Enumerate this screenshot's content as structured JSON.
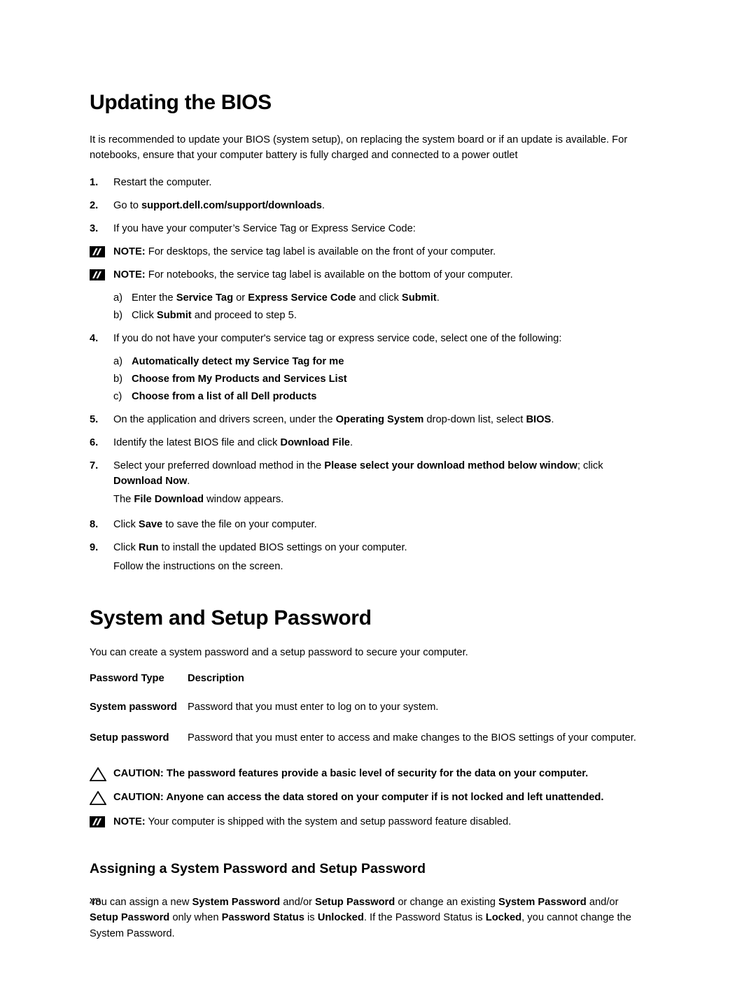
{
  "page": {
    "number": "48"
  },
  "section1": {
    "heading": "Updating the BIOS",
    "intro": "It is recommended to update your BIOS (system setup), on replacing the system board or if an update is available. For notebooks, ensure that your computer battery is fully charged and connected to a power outlet",
    "steps": [
      {
        "num": "1.",
        "text": "Restart the computer."
      },
      {
        "num": "2.",
        "text_parts": [
          {
            "t": "Go to ",
            "b": false
          },
          {
            "t": "support.dell.com/support/downloads",
            "b": true
          },
          {
            "t": ".",
            "b": false
          }
        ]
      },
      {
        "num": "3.",
        "text": "If you have your computer’s Service Tag or Express Service Code:"
      }
    ],
    "note1": {
      "label": "NOTE:",
      "text": " For desktops, the service tag label is available on the front of your computer."
    },
    "note2": {
      "label": "NOTE:",
      "text": " For notebooks, the service tag label is available on the bottom of your computer."
    },
    "sub3": [
      {
        "letter": "a)",
        "parts": [
          {
            "t": "Enter the ",
            "b": false
          },
          {
            "t": "Service Tag",
            "b": true
          },
          {
            "t": " or ",
            "b": false
          },
          {
            "t": "Express Service Code",
            "b": true
          },
          {
            "t": " and click ",
            "b": false
          },
          {
            "t": "Submit",
            "b": true
          },
          {
            "t": ".",
            "b": false
          }
        ]
      },
      {
        "letter": "b)",
        "parts": [
          {
            "t": "Click ",
            "b": false
          },
          {
            "t": "Submit",
            "b": true
          },
          {
            "t": " and proceed to step 5.",
            "b": false
          }
        ]
      }
    ],
    "step4": {
      "num": "4.",
      "text": "If you do not have your computer's service tag or express service code, select one of the following:"
    },
    "sub4": [
      {
        "letter": "a)",
        "parts": [
          {
            "t": "Automatically detect my Service Tag for me",
            "b": true
          }
        ]
      },
      {
        "letter": "b)",
        "parts": [
          {
            "t": "Choose from My Products and Services List",
            "b": true
          }
        ]
      },
      {
        "letter": "c)",
        "parts": [
          {
            "t": "Choose from a list of all Dell products",
            "b": true
          }
        ]
      }
    ],
    "steps_rest": [
      {
        "num": "5.",
        "parts": [
          {
            "t": "On the application and drivers screen, under the ",
            "b": false
          },
          {
            "t": "Operating System",
            "b": true
          },
          {
            "t": " drop-down list, select ",
            "b": false
          },
          {
            "t": "BIOS",
            "b": true
          },
          {
            "t": ".",
            "b": false
          }
        ]
      },
      {
        "num": "6.",
        "parts": [
          {
            "t": "Identify the latest BIOS file and click ",
            "b": false
          },
          {
            "t": "Download File",
            "b": true
          },
          {
            "t": ".",
            "b": false
          }
        ]
      },
      {
        "num": "7.",
        "parts": [
          {
            "t": "Select your preferred download method in the ",
            "b": false
          },
          {
            "t": "Please select your download method below window",
            "b": true
          },
          {
            "t": "; click ",
            "b": false
          },
          {
            "t": "Download Now",
            "b": true
          },
          {
            "t": ".",
            "b": false
          }
        ]
      }
    ],
    "step7_follow": [
      {
        "t": "The ",
        "b": false
      },
      {
        "t": "File Download",
        "b": true
      },
      {
        "t": " window appears.",
        "b": false
      }
    ],
    "steps_end": [
      {
        "num": "8.",
        "parts": [
          {
            "t": "Click ",
            "b": false
          },
          {
            "t": "Save",
            "b": true
          },
          {
            "t": " to save the file on your computer.",
            "b": false
          }
        ]
      },
      {
        "num": "9.",
        "parts": [
          {
            "t": "Click ",
            "b": false
          },
          {
            "t": "Run",
            "b": true
          },
          {
            "t": " to install the updated BIOS settings on your computer.",
            "b": false
          }
        ]
      }
    ],
    "final_line": "Follow the instructions on the screen."
  },
  "section2": {
    "heading": "System and Setup Password",
    "intro": "You can create a system password and a setup password to secure your computer.",
    "table": {
      "headers": [
        "Password Type",
        "Description"
      ],
      "rows": [
        [
          "System password",
          "Password that you must enter to log on to your system."
        ],
        [
          "Setup password",
          "Password that you must enter to access and make changes to the BIOS settings of your computer."
        ]
      ]
    },
    "cautions": [
      {
        "label": "CAUTION:",
        "text": " The password features provide a basic level of security for the data on your computer."
      },
      {
        "label": "CAUTION:",
        "text": " Anyone can access the data stored on your computer if is not locked and left unattended."
      }
    ],
    "note": {
      "label": "NOTE:",
      "text": " Your computer is shipped with the system and setup password feature disabled."
    },
    "subheading": "Assigning a System Password and Setup Password",
    "body_parts": [
      {
        "t": "You can assign a new ",
        "b": false
      },
      {
        "t": "System Password",
        "b": true
      },
      {
        "t": " and/or ",
        "b": false
      },
      {
        "t": "Setup Password",
        "b": true
      },
      {
        "t": " or change an existing ",
        "b": false
      },
      {
        "t": "System Password",
        "b": true
      },
      {
        "t": " and/or ",
        "b": false
      },
      {
        "t": "Setup Password",
        "b": true
      },
      {
        "t": " only when ",
        "b": false
      },
      {
        "t": "Password Status",
        "b": true
      },
      {
        "t": " is ",
        "b": false
      },
      {
        "t": "Unlocked",
        "b": true
      },
      {
        "t": ". If the Password Status is ",
        "b": false
      },
      {
        "t": "Locked",
        "b": true
      },
      {
        "t": ", you cannot change the System Password.",
        "b": false
      }
    ]
  }
}
